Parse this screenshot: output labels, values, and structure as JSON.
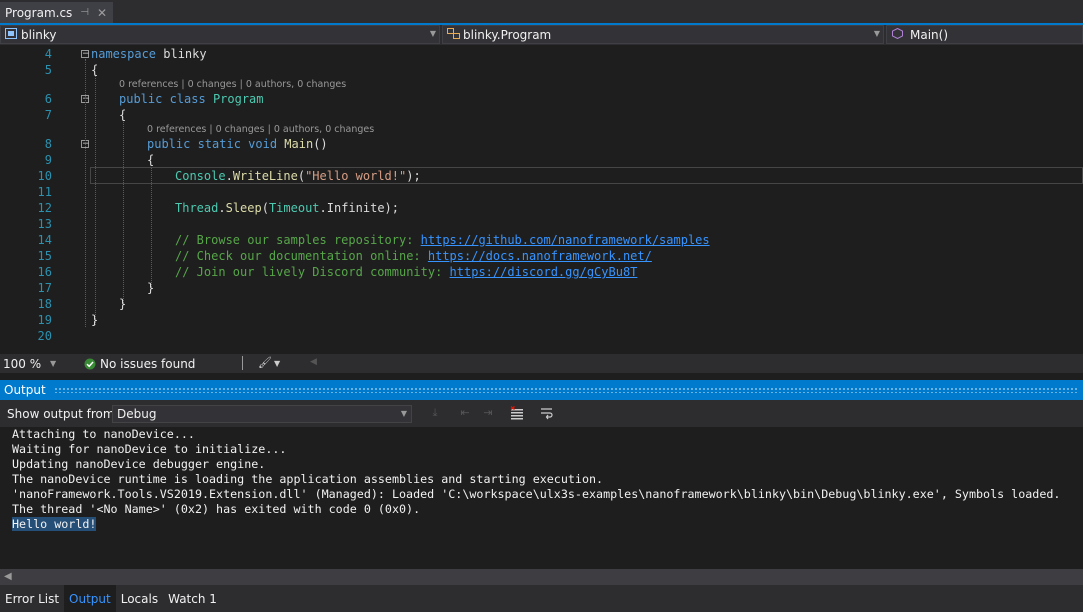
{
  "tab": {
    "title": "Program.cs",
    "pin": "⊣",
    "close": "✕"
  },
  "navbar": {
    "project": "blinky",
    "class": "blinky.Program",
    "member": "Main()"
  },
  "editor": {
    "line_numbers": [
      "4",
      "5",
      "6",
      "7",
      "8",
      "9",
      "10",
      "11",
      "12",
      "13",
      "14",
      "15",
      "16",
      "17",
      "18",
      "19",
      "20"
    ],
    "codelens": "0 references | 0 changes | 0 authors, 0 changes",
    "lines": {
      "l4_kw": "namespace",
      "l4_name": " blinky",
      "open_brace": "{",
      "close_brace": "}",
      "l6_kw": "public class",
      "l6_type": "Program",
      "l8_kw": "public static void",
      "l8_method": "Main",
      "l8_paren": "()",
      "l10_type": "Console",
      "l10_dot": ".",
      "l10_method": "WriteLine",
      "l10_open": "(",
      "l10_string": "\"Hello world!\"",
      "l10_close": ");",
      "l12_type": "Thread",
      "l12_dot": ".",
      "l12_method": "Sleep",
      "l12_open": "(",
      "l12_type2": "Timeout",
      "l12_rest": ".Infinite);",
      "l14_comment": "// Browse our samples repository: ",
      "l14_url": "https://github.com/nanoframework/samples",
      "l15_comment": "// Check our documentation online: ",
      "l15_url": "https://docs.nanoframework.net/",
      "l16_comment": "// Join our lively Discord community: ",
      "l16_url": "https://discord.gg/gCyBu8T"
    }
  },
  "edstatus": {
    "zoom": "100 %",
    "issues": "No issues found"
  },
  "output_panel": {
    "title": "Output",
    "show_from_label": "Show output from:",
    "source": "Debug",
    "lines": [
      "Attaching to nanoDevice...",
      "Waiting for nanoDevice to initialize...",
      "Updating nanoDevice debugger engine.",
      "The nanoDevice runtime is loading the application assemblies and starting execution.",
      "'nanoFramework.Tools.VS2019.Extension.dll' (Managed): Loaded 'C:\\workspace\\ulx3s-examples\\nanoframework\\blinky\\bin\\Debug\\blinky.exe', Symbols loaded.",
      "The thread '<No Name>' (0x2) has exited with code 0 (0x0).",
      "Hello world!"
    ]
  },
  "bottom_tabs": [
    "Error List",
    "Output",
    "Locals",
    "Watch 1"
  ],
  "colors": {
    "accent": "#007acc",
    "keyword": "#569cd6",
    "type": "#4ec9b0",
    "string": "#d69d85",
    "comment": "#57a64a",
    "link": "#3794ff"
  }
}
